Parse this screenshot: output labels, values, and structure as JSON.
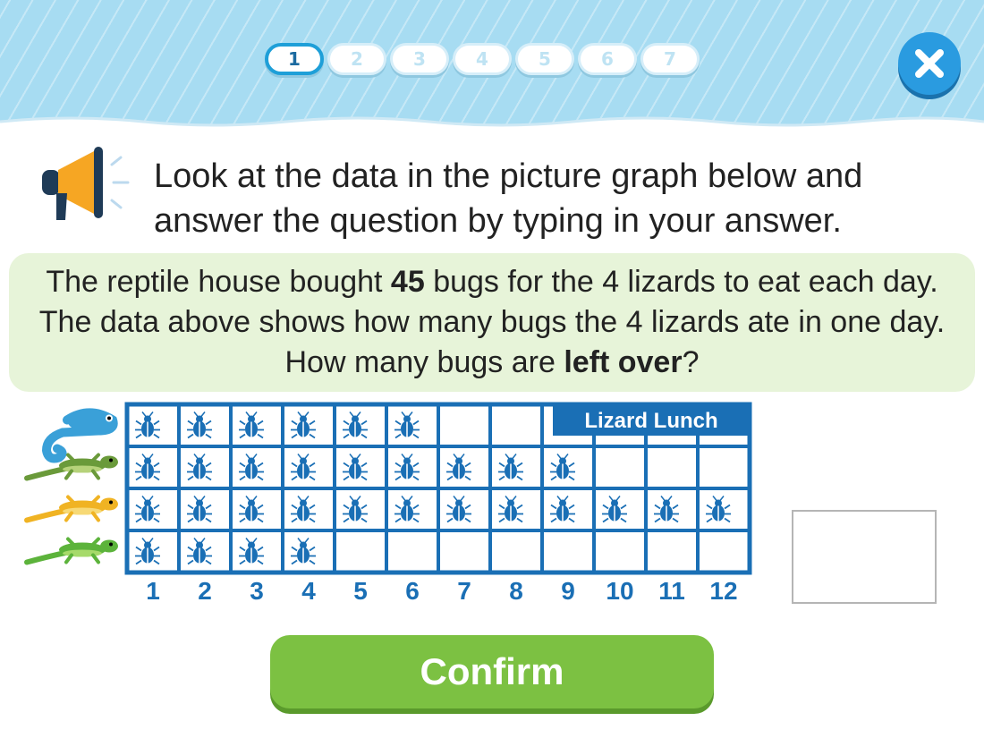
{
  "header": {
    "steps": [
      "1",
      "2",
      "3",
      "4",
      "5",
      "6",
      "7"
    ],
    "active_step": 1,
    "close_icon": "close-x-icon"
  },
  "instruction": {
    "icon": "megaphone-icon",
    "text": "Look at the data in the picture graph below and answer the question by typing in your answer."
  },
  "question": {
    "part1": "The reptile house bought ",
    "bold1": "45",
    "part2": " bugs for the 4 lizards to eat each day. The data above shows how many bugs the 4 lizards ate in one day. How many bugs are ",
    "bold2": "left over",
    "part3": "?"
  },
  "graph": {
    "title": "Lizard Lunch",
    "columns": [
      "1",
      "2",
      "3",
      "4",
      "5",
      "6",
      "7",
      "8",
      "9",
      "10",
      "11",
      "12"
    ],
    "rows": [
      {
        "lizard": "blue-chameleon-icon",
        "bugs": 6
      },
      {
        "lizard": "green-iguana-icon",
        "bugs": 9
      },
      {
        "lizard": "yellow-lizard-icon",
        "bugs": 12
      },
      {
        "lizard": "green-gecko-icon",
        "bugs": 4
      }
    ],
    "bug_icon": "beetle-icon",
    "colors": {
      "grid": "#1a6fb5",
      "bug": "#1a6fb5"
    }
  },
  "answer": {
    "value": ""
  },
  "confirm": {
    "label": "Confirm"
  },
  "colors": {
    "header": "#a7dcf2",
    "confirm": "#7cc142",
    "question_bg": "#e7f4d9",
    "close": "#2a9be0"
  }
}
